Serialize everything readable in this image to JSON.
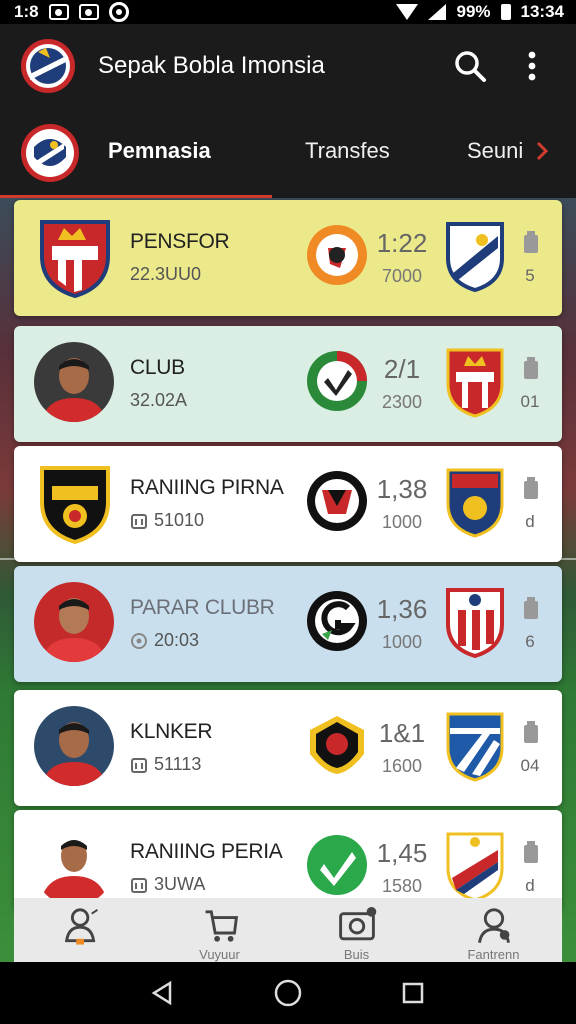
{
  "status_bar": {
    "time_left": "1:8",
    "battery": "99%",
    "clock": "13:34"
  },
  "app_bar": {
    "title": "Sepak Bobla Imonsia",
    "search_icon": "search-icon",
    "more_icon": "more-vert-icon"
  },
  "tabs": [
    {
      "label": "Pemnasia",
      "active": true
    },
    {
      "label": "Transfes",
      "active": false
    },
    {
      "label": "Seuni",
      "active": false
    }
  ],
  "cards": [
    {
      "name": "PENSFOR",
      "sub": "22.3UU0",
      "score": "1:22",
      "odds": "7000",
      "count": "5",
      "bg": "#ebe98a",
      "left": "crest"
    },
    {
      "name": "CLUB",
      "sub": "32.02A",
      "score": "2/1",
      "odds": "2300",
      "count": "01",
      "bg": "#dbeee3",
      "left": "player"
    },
    {
      "name": "RANIING PIRNA",
      "sub": "51010",
      "score": "1,38",
      "odds": "1000",
      "count": "d",
      "bg": "#ffffff",
      "left": "crest"
    },
    {
      "name": "PARAR CLUBR",
      "sub": "20:03",
      "score": "1,36",
      "odds": "1000",
      "count": "6",
      "bg": "#c9dfee",
      "left": "player"
    },
    {
      "name": "KLNKER",
      "sub": "51113",
      "score": "1&1",
      "odds": "1600",
      "count": "04",
      "bg": "#ffffff",
      "left": "player"
    },
    {
      "name": "RANIING PERIA",
      "sub": "3UWA",
      "score": "1,45",
      "odds": "1580",
      "count": "d",
      "bg": "#ffffff",
      "left": "player"
    }
  ],
  "bottom_nav": [
    {
      "label": "",
      "icon": "profile-icon"
    },
    {
      "label": "Vuyuur",
      "icon": "cart-icon"
    },
    {
      "label": "Buis",
      "icon": "media-icon"
    },
    {
      "label": "Fantrenn",
      "icon": "user-icon"
    }
  ],
  "colors": {
    "accent": "#d23c2e",
    "app_bar": "#1b1b1b"
  }
}
